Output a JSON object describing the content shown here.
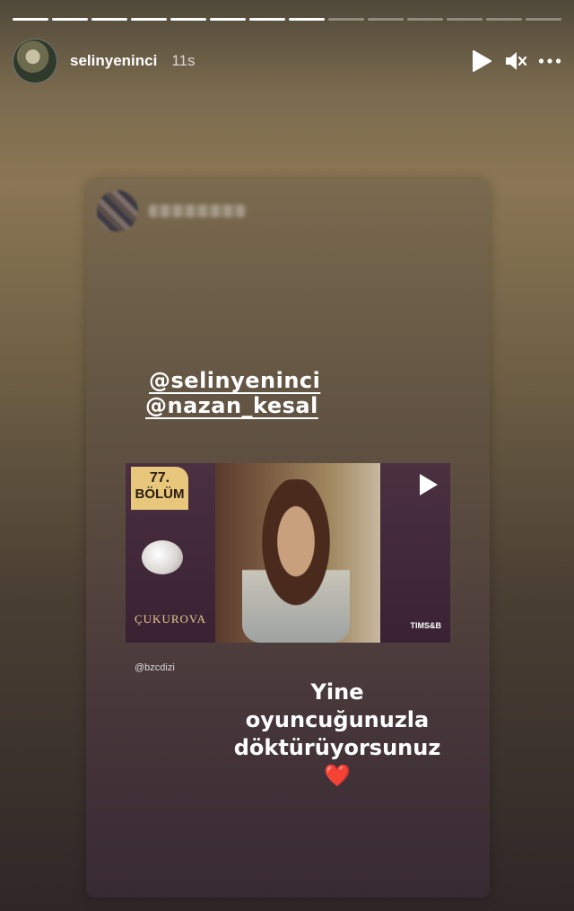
{
  "story": {
    "progress": {
      "total": 14,
      "viewed": 8
    },
    "username": "selinyeninci",
    "time": "11s"
  },
  "controls": {
    "play_icon": "play-icon",
    "mute_icon": "volume-mute-icon",
    "more_icon": "more-horizontal-icon"
  },
  "shared_post": {
    "mentions": [
      "@selinyeninci",
      "@nazan_kesal"
    ],
    "video": {
      "episode_number": "77.",
      "episode_label": "BÖLÜM",
      "show_title": "ÇUKUROVA",
      "channel": "TIMS&B"
    },
    "source": "@bzcdizi",
    "caption_line1": "Yine oyuncuğunuzla",
    "caption_line2": "döktürüyorsunuz",
    "caption_emoji": "❤️"
  },
  "colors": {
    "heart": "#e0242f",
    "badge": "#e7c77b"
  }
}
